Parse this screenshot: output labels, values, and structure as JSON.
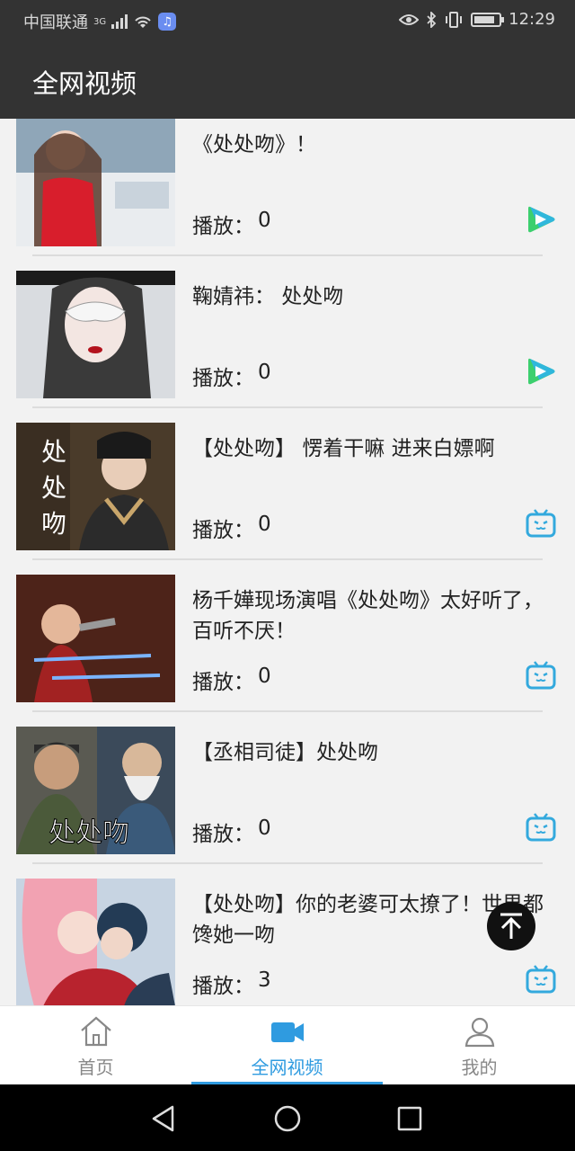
{
  "status_bar": {
    "carrier": "中国联通",
    "network": "3G",
    "time": "12:29",
    "battery_level": 0.85
  },
  "header": {
    "title": "全网视频"
  },
  "video_list": {
    "plays_label": "播放：",
    "items": [
      {
        "title": "《处处吻》！",
        "plays": "0",
        "source_icon": "play-triangle-icon"
      },
      {
        "title": "鞠婧祎： 处处吻",
        "plays": "0",
        "source_icon": "play-triangle-icon"
      },
      {
        "title": "【处处吻】 愣着干嘛 进来白嫖啊",
        "plays": "0",
        "source_icon": "tv-icon"
      },
      {
        "title": "杨千嬅现场演唱《处处吻》太好听了，百听不厌！",
        "plays": "0",
        "source_icon": "tv-icon"
      },
      {
        "title": "【丞相司徒】处处吻",
        "plays": "0",
        "source_icon": "tv-icon"
      },
      {
        "title": "【处处吻】你的老婆可太撩了！世界都馋她一吻",
        "plays": "3",
        "source_icon": "tv-icon"
      }
    ]
  },
  "bottom_nav": {
    "items": [
      {
        "label": "首页",
        "icon": "home-icon",
        "active": false
      },
      {
        "label": "全网视频",
        "icon": "video-camera-icon",
        "active": true
      },
      {
        "label": "我的",
        "icon": "user-icon",
        "active": false
      }
    ]
  },
  "colors": {
    "accent": "#2f9be0",
    "header_bg": "#333333",
    "play_green": "#3ccf6e",
    "tv_blue": "#33a9dd"
  }
}
